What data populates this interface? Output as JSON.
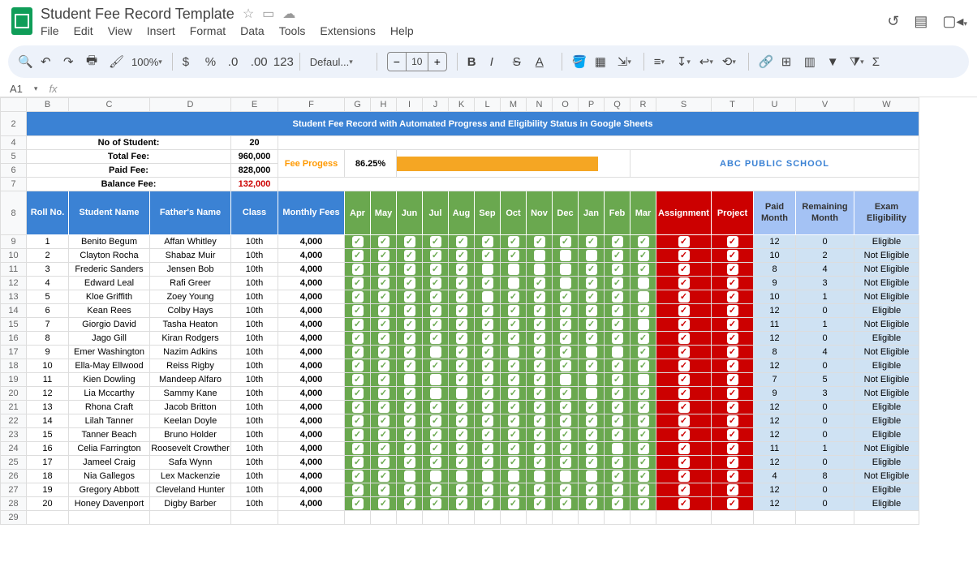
{
  "doc": {
    "title": "Student Fee Record Template"
  },
  "menu": [
    "File",
    "Edit",
    "View",
    "Insert",
    "Format",
    "Data",
    "Tools",
    "Extensions",
    "Help"
  ],
  "toolbar": {
    "zoom": "100%",
    "fontname": "Defaul...",
    "fontsize": "10"
  },
  "cellref": "A1",
  "cols": [
    "",
    "B",
    "C",
    "D",
    "E",
    "F",
    "G",
    "H",
    "I",
    "J",
    "K",
    "L",
    "M",
    "N",
    "O",
    "P",
    "Q",
    "R",
    "S",
    "T",
    "U",
    "V",
    "W"
  ],
  "banner": "Student Fee Record with Automated Progress and Eligibility Status in Google Sheets",
  "summary": {
    "l1": "No of Student:",
    "v1": "20",
    "l2": "Total Fee:",
    "v2": "960,000",
    "l3": "Paid Fee:",
    "v3": "828,000",
    "l4": "Balance Fee:",
    "v4": "132,000",
    "feeprog": "Fee Progess",
    "pct": "86.25%",
    "school": "ABC PUBLIC SCHOOL"
  },
  "headers": {
    "roll": "Roll No.",
    "name": "Student Name",
    "father": "Father's Name",
    "class": "Class",
    "fee": "Monthly Fees",
    "months": [
      "Apr",
      "May",
      "Jun",
      "Jul",
      "Aug",
      "Sep",
      "Oct",
      "Nov",
      "Dec",
      "Jan",
      "Feb",
      "Mar"
    ],
    "assign": "Assignment",
    "proj": "Project",
    "paid": "Paid Month",
    "remain": "Remaining Month",
    "elig": "Exam Eligibility"
  },
  "rows": [
    {
      "r": 9,
      "roll": 1,
      "name": "Benito Begum",
      "father": "Affan Whitley",
      "class": "10th",
      "fee": "4,000",
      "m": [
        1,
        1,
        1,
        1,
        1,
        1,
        1,
        1,
        1,
        1,
        1,
        1
      ],
      "a": 1,
      "p": 1,
      "paid": 12,
      "rem": 0,
      "elig": "Eligible"
    },
    {
      "r": 10,
      "roll": 2,
      "name": "Clayton Rocha",
      "father": "Shabaz Muir",
      "class": "10th",
      "fee": "4,000",
      "m": [
        1,
        1,
        1,
        1,
        1,
        1,
        1,
        0,
        0,
        0,
        1,
        1
      ],
      "a": 1,
      "p": 1,
      "paid": 10,
      "rem": 2,
      "elig": "Not Eligible"
    },
    {
      "r": 11,
      "roll": 3,
      "name": "Frederic Sanders",
      "father": "Jensen Bob",
      "class": "10th",
      "fee": "4,000",
      "m": [
        1,
        1,
        1,
        1,
        1,
        0,
        0,
        0,
        0,
        1,
        1,
        1
      ],
      "a": 1,
      "p": 1,
      "paid": 8,
      "rem": 4,
      "elig": "Not Eligible"
    },
    {
      "r": 12,
      "roll": 4,
      "name": "Edward Leal",
      "father": "Rafi Greer",
      "class": "10th",
      "fee": "4,000",
      "m": [
        1,
        1,
        1,
        1,
        1,
        1,
        0,
        1,
        0,
        1,
        1,
        0
      ],
      "a": 1,
      "p": 1,
      "paid": 9,
      "rem": 3,
      "elig": "Not Eligible"
    },
    {
      "r": 13,
      "roll": 5,
      "name": "Kloe Griffith",
      "father": "Zoey Young",
      "class": "10th",
      "fee": "4,000",
      "m": [
        1,
        1,
        1,
        1,
        1,
        0,
        1,
        1,
        1,
        1,
        1,
        0
      ],
      "a": 1,
      "p": 1,
      "paid": 10,
      "rem": 1,
      "elig": "Not Eligible"
    },
    {
      "r": 14,
      "roll": 6,
      "name": "Kean Rees",
      "father": "Colby Hays",
      "class": "10th",
      "fee": "4,000",
      "m": [
        1,
        1,
        1,
        1,
        1,
        1,
        1,
        1,
        1,
        1,
        1,
        1
      ],
      "a": 1,
      "p": 0,
      "paid": 12,
      "rem": 0,
      "elig": "Eligible"
    },
    {
      "r": 15,
      "roll": 7,
      "name": "Giorgio David",
      "father": "Tasha Heaton",
      "class": "10th",
      "fee": "4,000",
      "m": [
        1,
        1,
        1,
        1,
        1,
        1,
        1,
        1,
        1,
        1,
        1,
        0
      ],
      "a": 0,
      "p": 1,
      "paid": 11,
      "rem": 1,
      "elig": "Not Eligible"
    },
    {
      "r": 16,
      "roll": 8,
      "name": "Jago Gill",
      "father": "Kiran Rodgers",
      "class": "10th",
      "fee": "4,000",
      "m": [
        1,
        1,
        1,
        1,
        1,
        1,
        1,
        1,
        1,
        1,
        1,
        1
      ],
      "a": 1,
      "p": 0,
      "paid": 12,
      "rem": 0,
      "elig": "Eligible"
    },
    {
      "r": 17,
      "roll": 9,
      "name": "Emer Washington",
      "father": "Nazim Adkins",
      "class": "10th",
      "fee": "4,000",
      "m": [
        1,
        1,
        1,
        0,
        1,
        1,
        0,
        1,
        1,
        0,
        0,
        1
      ],
      "a": 1,
      "p": 0,
      "paid": 8,
      "rem": 4,
      "elig": "Not Eligible"
    },
    {
      "r": 18,
      "roll": 10,
      "name": "Ella-May Ellwood",
      "father": "Reiss Rigby",
      "class": "10th",
      "fee": "4,000",
      "m": [
        1,
        1,
        1,
        1,
        1,
        1,
        1,
        1,
        1,
        1,
        1,
        1
      ],
      "a": 1,
      "p": 0,
      "paid": 12,
      "rem": 0,
      "elig": "Eligible"
    },
    {
      "r": 19,
      "roll": 11,
      "name": "Kien Dowling",
      "father": "Mandeep Alfaro",
      "class": "10th",
      "fee": "4,000",
      "m": [
        1,
        1,
        0,
        0,
        1,
        1,
        1,
        1,
        0,
        0,
        1,
        0
      ],
      "a": 1,
      "p": 0,
      "paid": 7,
      "rem": 5,
      "elig": "Not Eligible"
    },
    {
      "r": 20,
      "roll": 12,
      "name": "Lia Mccarthy",
      "father": "Sammy Kane",
      "class": "10th",
      "fee": "4,000",
      "m": [
        1,
        1,
        1,
        0,
        0,
        1,
        1,
        1,
        1,
        0,
        1,
        1
      ],
      "a": 0,
      "p": 1,
      "paid": 9,
      "rem": 3,
      "elig": "Not Eligible"
    },
    {
      "r": 21,
      "roll": 13,
      "name": "Rhona Craft",
      "father": "Jacob Britton",
      "class": "10th",
      "fee": "4,000",
      "m": [
        1,
        1,
        1,
        1,
        1,
        1,
        1,
        1,
        1,
        1,
        1,
        1
      ],
      "a": 1,
      "p": 1,
      "paid": 12,
      "rem": 0,
      "elig": "Eligible"
    },
    {
      "r": 22,
      "roll": 14,
      "name": "Lilah Tanner",
      "father": "Keelan Doyle",
      "class": "10th",
      "fee": "4,000",
      "m": [
        1,
        1,
        1,
        1,
        1,
        1,
        1,
        1,
        1,
        1,
        1,
        1
      ],
      "a": 1,
      "p": 0,
      "paid": 12,
      "rem": 0,
      "elig": "Eligible"
    },
    {
      "r": 23,
      "roll": 15,
      "name": "Tanner Beach",
      "father": "Bruno Holder",
      "class": "10th",
      "fee": "4,000",
      "m": [
        1,
        1,
        1,
        1,
        1,
        1,
        1,
        1,
        1,
        1,
        1,
        1
      ],
      "a": 0,
      "p": 1,
      "paid": 12,
      "rem": 0,
      "elig": "Eligible"
    },
    {
      "r": 24,
      "roll": 16,
      "name": "Celia Farrington",
      "father": "Roosevelt Crowther",
      "class": "10th",
      "fee": "4,000",
      "m": [
        1,
        1,
        1,
        1,
        1,
        1,
        1,
        1,
        1,
        1,
        0,
        1
      ],
      "a": 1,
      "p": 1,
      "paid": 11,
      "rem": 1,
      "elig": "Not Eligible"
    },
    {
      "r": 25,
      "roll": 17,
      "name": "Jameel Craig",
      "father": "Safa Wynn",
      "class": "10th",
      "fee": "4,000",
      "m": [
        1,
        1,
        1,
        1,
        1,
        1,
        1,
        1,
        1,
        1,
        1,
        1
      ],
      "a": 1,
      "p": 1,
      "paid": 12,
      "rem": 0,
      "elig": "Eligible"
    },
    {
      "r": 26,
      "roll": 18,
      "name": "Nia Gallegos",
      "father": "Lex Mackenzie",
      "class": "10th",
      "fee": "4,000",
      "m": [
        1,
        1,
        0,
        0,
        0,
        0,
        0,
        0,
        0,
        0,
        1,
        1
      ],
      "a": 1,
      "p": 1,
      "paid": 4,
      "rem": 8,
      "elig": "Not Eligible"
    },
    {
      "r": 27,
      "roll": 19,
      "name": "Gregory Abbott",
      "father": "Cleveland Hunter",
      "class": "10th",
      "fee": "4,000",
      "m": [
        1,
        1,
        1,
        1,
        1,
        1,
        1,
        1,
        1,
        1,
        1,
        1
      ],
      "a": 1,
      "p": 1,
      "paid": 12,
      "rem": 0,
      "elig": "Eligible"
    },
    {
      "r": 28,
      "roll": 20,
      "name": "Honey Davenport",
      "father": "Digby Barber",
      "class": "10th",
      "fee": "4,000",
      "m": [
        1,
        1,
        1,
        1,
        1,
        1,
        1,
        1,
        1,
        1,
        1,
        1
      ],
      "a": 1,
      "p": 0,
      "paid": 12,
      "rem": 0,
      "elig": "Eligible"
    }
  ]
}
